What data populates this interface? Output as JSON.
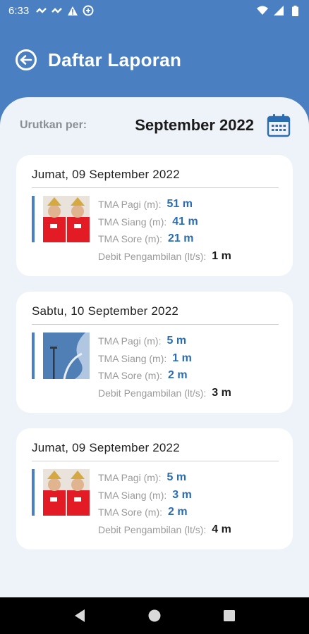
{
  "statusbar": {
    "time": "6:33"
  },
  "appbar": {
    "title": "Daftar Laporan"
  },
  "sort": {
    "label": "Urutkan per:",
    "month": "September 2022"
  },
  "reports": [
    {
      "date": "Jumat, 09 September 2022",
      "tma_pagi_label": "TMA Pagi (m):",
      "tma_pagi": "51 m",
      "tma_siang_label": "TMA Siang (m):",
      "tma_siang": "41 m",
      "tma_sore_label": "TMA Sore (m):",
      "tma_sore": "21 m",
      "debit_label": "Debit Pengambilan (lt/s):",
      "debit": "1 m"
    },
    {
      "date": "Sabtu, 10 September 2022",
      "tma_pagi_label": "TMA Pagi (m):",
      "tma_pagi": "5 m",
      "tma_siang_label": "TMA Siang (m):",
      "tma_siang": "1 m",
      "tma_sore_label": "TMA Sore (m):",
      "tma_sore": "2 m",
      "debit_label": "Debit Pengambilan (lt/s):",
      "debit": "3 m"
    },
    {
      "date": "Jumat, 09 September 2022",
      "tma_pagi_label": "TMA Pagi (m):",
      "tma_pagi": "5 m",
      "tma_siang_label": "TMA Siang (m):",
      "tma_siang": "3 m",
      "tma_sore_label": "TMA Sore (m):",
      "tma_sore": "2 m",
      "debit_label": "Debit Pengambilan (lt/s):",
      "debit": "4 m"
    }
  ],
  "colors": {
    "primary": "#4a7fc1",
    "value": "#2a6db3",
    "sheet": "#eef3f9"
  }
}
